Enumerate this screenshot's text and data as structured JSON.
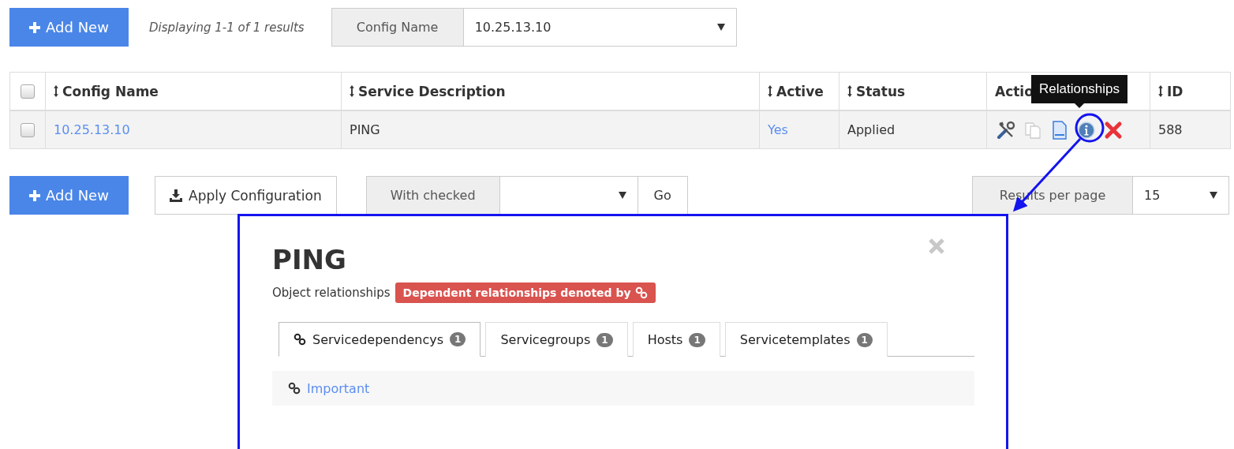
{
  "toolbar_top": {
    "add_button": "Add New",
    "results_text": "Displaying 1-1 of 1 results",
    "filter": {
      "label": "Config Name",
      "value": "10.25.13.10"
    }
  },
  "table": {
    "select_all_checked": false,
    "columns": [
      {
        "label": "Config Name",
        "sortable": true
      },
      {
        "label": "Service Description",
        "sortable": true
      },
      {
        "label": "Active",
        "sortable": true
      },
      {
        "label": "Status",
        "sortable": true
      },
      {
        "label": "Actio",
        "sortable": false
      },
      {
        "label": "ID",
        "sortable": true
      }
    ],
    "rows": [
      {
        "checked": false,
        "config_name": "10.25.13.10",
        "service_description": "PING",
        "active": "Yes",
        "status": "Applied",
        "id": "588"
      }
    ]
  },
  "tooltip": "Relationships",
  "toolbar_bottom": {
    "add_button": "Add New",
    "apply_button": "Apply Configuration",
    "bulk": {
      "label": "With checked",
      "go": "Go"
    },
    "per_page": {
      "label": "Results per page",
      "value": "15"
    }
  },
  "modal": {
    "title": "PING",
    "subtitle": "Object relationships",
    "badge": "Dependent relationships denoted by",
    "tabs": [
      {
        "label": "Servicedependencys",
        "count": "1",
        "selected": true,
        "dependent": true
      },
      {
        "label": "Servicegroups",
        "count": "1",
        "selected": false,
        "dependent": false
      },
      {
        "label": "Hosts",
        "count": "1",
        "selected": false,
        "dependent": false
      },
      {
        "label": "Servicetemplates",
        "count": "1",
        "selected": false,
        "dependent": false
      }
    ],
    "items": [
      {
        "label": "Important",
        "dependent": true
      }
    ]
  }
}
